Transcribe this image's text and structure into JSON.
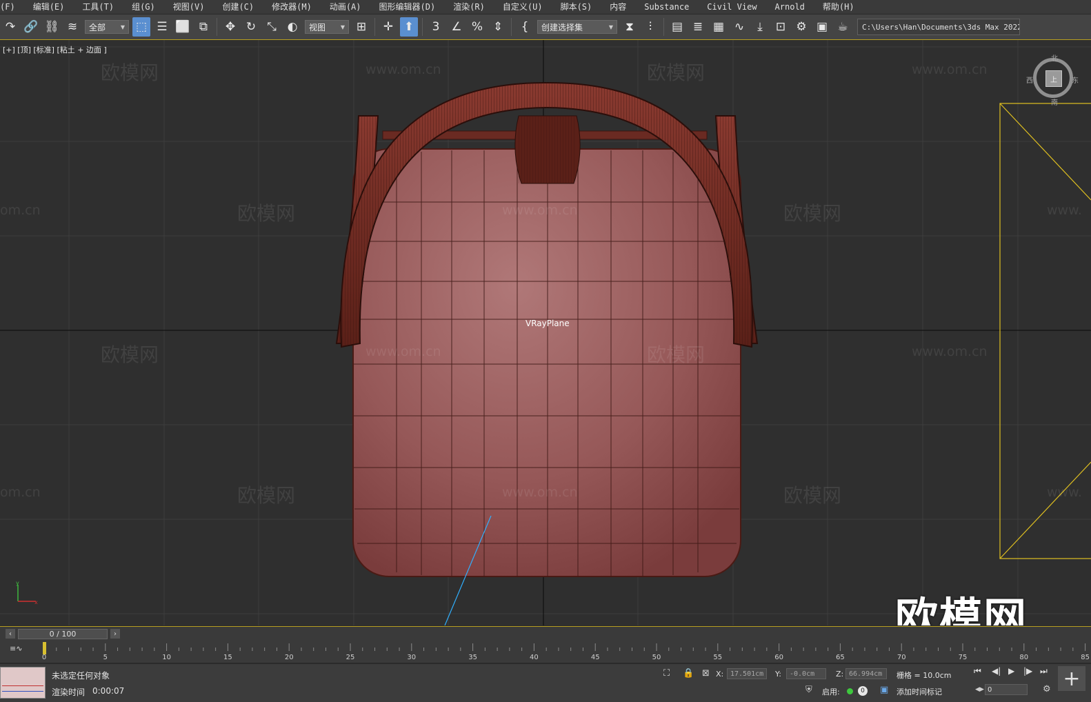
{
  "menu": [
    "(F)",
    "编辑(E)",
    "工具(T)",
    "组(G)",
    "视图(V)",
    "创建(C)",
    "修改器(M)",
    "动画(A)",
    "图形编辑器(D)",
    "渲染(R)",
    "自定义(U)",
    "脚本(S)",
    "内容",
    "Substance",
    "Civil View",
    "Arnold",
    "帮助(H)"
  ],
  "toolbar": {
    "selection_filter": "全部",
    "ref_coord": "视图",
    "named_selection": "创建选择集",
    "project_path": "C:\\Users\\Han\\Documents\\3ds Max 2022"
  },
  "viewport": {
    "label": "[+] [顶] [标准] [粘土 + 边面 ]",
    "object_label": "VRayPlane",
    "compass": {
      "n": "北",
      "s": "南",
      "e": "东",
      "w": "西",
      "face": "上"
    }
  },
  "watermarks": {
    "cn": "欧模网",
    "url": "www.om.cn",
    "short_url": "om.cn",
    "tail_url": "www.",
    "big": "欧模网"
  },
  "timeslider": {
    "frame": "0 / 100"
  },
  "track_ticks": [
    "0",
    "5",
    "10",
    "15",
    "20",
    "25",
    "30",
    "35",
    "40",
    "45",
    "50",
    "55",
    "60",
    "65",
    "70",
    "75",
    "80",
    "85"
  ],
  "status": {
    "selection": "未选定任何对象",
    "render_time_label": "渲染时间",
    "render_time": "0:00:07",
    "x_label": "X:",
    "x": "17.501cm",
    "y_label": "Y:",
    "y": "-0.0cm",
    "z_label": "Z:",
    "z": "66.994cm",
    "grid": "栅格 = 10.0cm",
    "enable_label": "启用:",
    "zero": "0",
    "add_time_tag": "添加时间标记",
    "frame_value": "0"
  }
}
